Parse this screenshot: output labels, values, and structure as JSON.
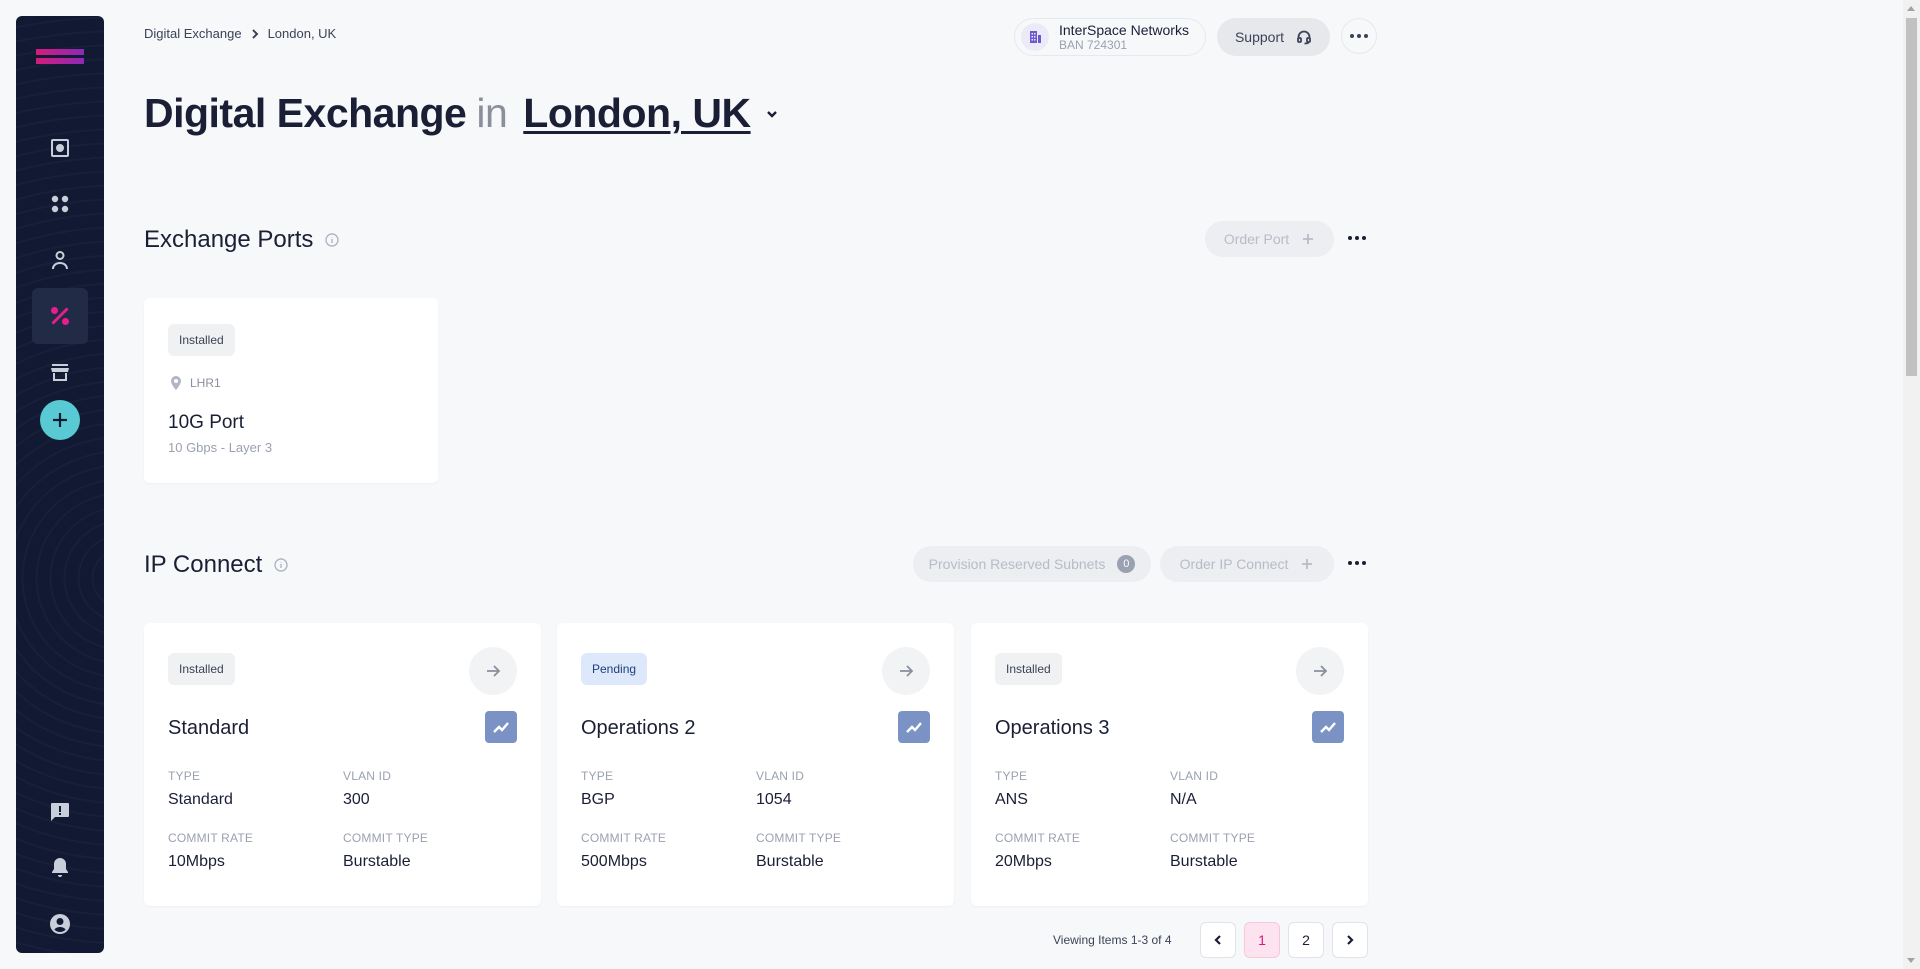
{
  "breadcrumb": {
    "root": "Digital Exchange",
    "current": "London, UK"
  },
  "account": {
    "name": "InterSpace Networks",
    "ban": "BAN 724301"
  },
  "header": {
    "support_label": "Support"
  },
  "title": {
    "product": "Digital Exchange",
    "connector": "in",
    "location": "London, UK"
  },
  "exchange_ports": {
    "title": "Exchange Ports",
    "order_label": "Order Port",
    "card": {
      "status": "Installed",
      "site": "LHR1",
      "name": "10G Port",
      "detail": "10 Gbps - Layer 3"
    }
  },
  "ip_connect": {
    "title": "IP Connect",
    "provision_label": "Provision Reserved Subnets",
    "provision_count": "0",
    "order_label": "Order IP Connect",
    "labels": {
      "type": "TYPE",
      "vlan": "VLAN ID",
      "rate": "COMMIT RATE",
      "commit_type": "COMMIT TYPE"
    },
    "cards": [
      {
        "status": "Installed",
        "name": "Standard",
        "type": "Standard",
        "vlan": "300",
        "rate": "10Mbps",
        "commit_type": "Burstable"
      },
      {
        "status": "Pending",
        "name": "Operations 2",
        "type": "BGP",
        "vlan": "1054",
        "rate": "500Mbps",
        "commit_type": "Burstable"
      },
      {
        "status": "Installed",
        "name": "Operations 3",
        "type": "ANS",
        "vlan": "N/A",
        "rate": "20Mbps",
        "commit_type": "Burstable"
      }
    ]
  },
  "pagination": {
    "summary": "Viewing Items 1-3 of 4",
    "pages": [
      "1",
      "2"
    ],
    "current": "1"
  },
  "colors": {
    "sidebar": "#121a33",
    "accent": "#e91e8c",
    "add_button": "#59c9d3",
    "chart_button": "#7b93c4",
    "pending_badge": "#dde9fb"
  }
}
